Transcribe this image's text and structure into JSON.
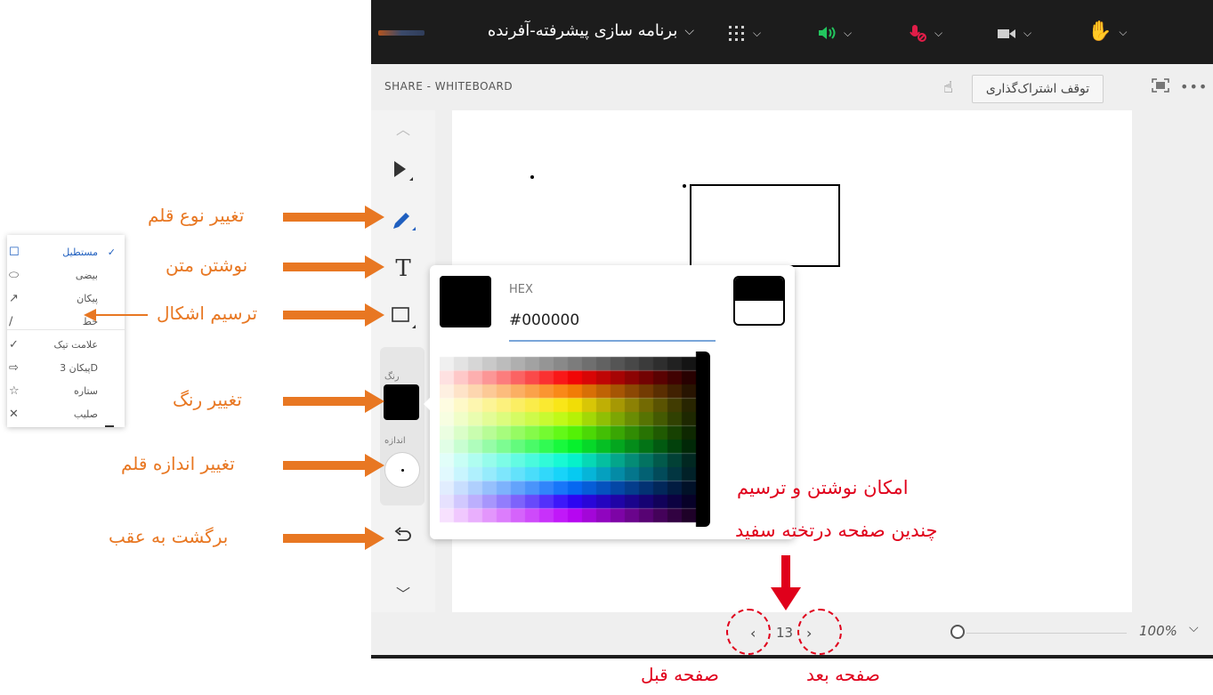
{
  "app": {
    "meeting_title": "برنامه سازی پیشرفته-آفرنده",
    "share_title": "SHARE - WHITEBOARD",
    "stop_sharing": "توقف اشتراک‌گذاری"
  },
  "topbar": {
    "icons": [
      "apps-grid-icon",
      "speaker-icon",
      "mic-muted-icon",
      "camera-icon",
      "raise-hand-icon"
    ],
    "colors": {
      "speaker": "#22c55e",
      "mic_muted": "#e11d48"
    }
  },
  "toolbar": {
    "color_label": "رنگ",
    "size_label": "اندازه",
    "current_color": "#000000"
  },
  "picker": {
    "hex_label": "HEX",
    "hex_value": "#000000"
  },
  "shapes_menu": {
    "items": [
      {
        "label": "مستطیل",
        "icon": "rectangle-icon",
        "selected": true
      },
      {
        "label": "بیضی",
        "icon": "ellipse-icon",
        "selected": false
      },
      {
        "label": "پیکان",
        "icon": "arrow-icon",
        "selected": false
      },
      {
        "label": "خط",
        "icon": "line-icon",
        "selected": false
      },
      {
        "label": "علامت تیک",
        "icon": "check-icon",
        "selected": false
      },
      {
        "label": "Dپیکان 3",
        "icon": "arrow-3d-icon",
        "selected": false
      },
      {
        "label": "ستاره",
        "icon": "star-icon",
        "selected": false
      },
      {
        "label": "صلیب",
        "icon": "cross-icon",
        "selected": false
      }
    ]
  },
  "pager": {
    "page_number": "13",
    "zoom": "100%"
  },
  "annotations": {
    "pen_type": "تغییر نوع قلم",
    "write_text": "نوشتن متن",
    "draw_shapes": "ترسیم اشکال",
    "change_color": "تغییر رنگ",
    "pen_size": "تغییر اندازه قلم",
    "undo": "برگشت به عقب",
    "multi_page_line1": "امکان   نوشتن   و   ترسیم",
    "multi_page_line2": "چندین صفحه درتخته سفید",
    "prev_page": "صفحه قبل",
    "next_page": "صفحه بعد"
  }
}
